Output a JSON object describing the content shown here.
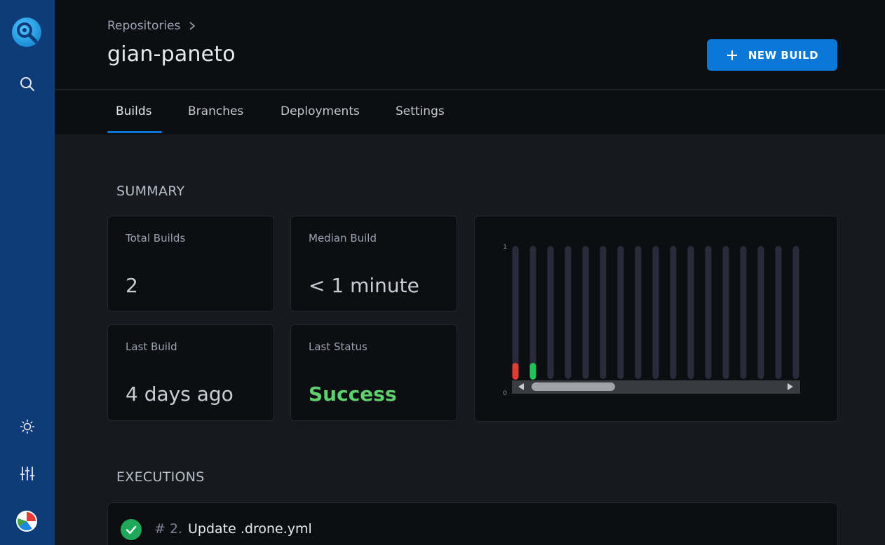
{
  "sidebar": {
    "icons": [
      "logo-icon",
      "search-icon",
      "theme-toggle-icon",
      "settings-sliders-icon",
      "avatar"
    ]
  },
  "header": {
    "breadcrumb": "Repositories",
    "title": "gian-paneto",
    "new_build_label": "NEW BUILD"
  },
  "tabs": [
    {
      "label": "Builds",
      "active": true
    },
    {
      "label": "Branches",
      "active": false
    },
    {
      "label": "Deployments",
      "active": false
    },
    {
      "label": "Settings",
      "active": false
    }
  ],
  "summary": {
    "heading": "SUMMARY",
    "total_builds_label": "Total Builds",
    "total_builds_value": "2",
    "median_build_label": "Median Build",
    "median_build_value": "< 1 minute",
    "last_build_label": "Last Build",
    "last_build_value": "4 days ago",
    "last_status_label": "Last Status",
    "last_status_value": "Success"
  },
  "chart_data": {
    "type": "bar",
    "title": "",
    "xlabel": "",
    "ylabel": "",
    "ylim": [
      0,
      1
    ],
    "y_ticks": [
      "1",
      "0"
    ],
    "bars": 17,
    "builds": [
      {
        "status": "failure",
        "color": "#e53935"
      },
      {
        "status": "success",
        "color": "#1fc35a"
      }
    ],
    "scrollbar": true
  },
  "executions": {
    "heading": "EXECUTIONS",
    "items": [
      {
        "number": "# 2.",
        "message": "Update .drone.yml",
        "status": "success"
      }
    ]
  },
  "colors": {
    "accent": "#0b78d8",
    "success": "#5fd06e",
    "failure": "#e53935",
    "sidebar": "#0f3c78"
  }
}
